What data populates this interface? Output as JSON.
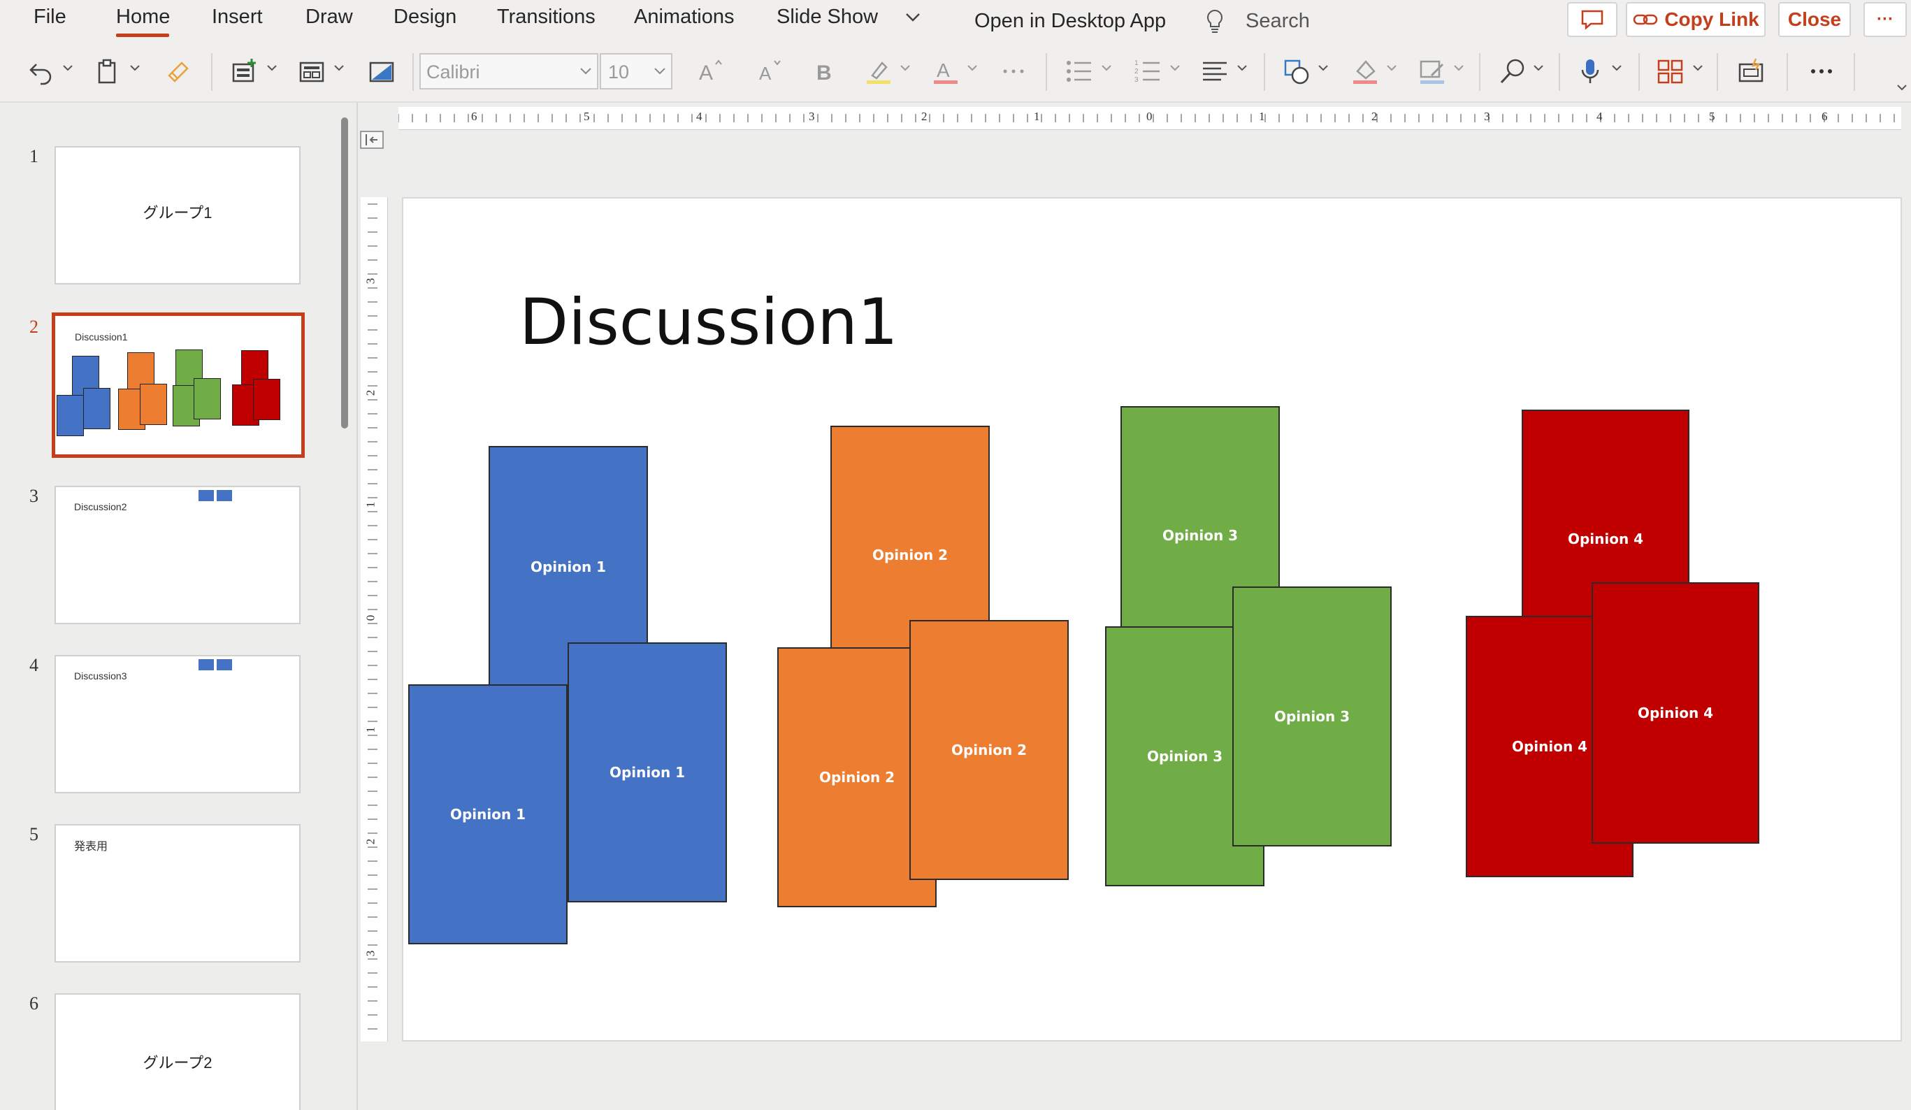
{
  "menu": {
    "file": "File",
    "home": "Home",
    "insert": "Insert",
    "draw": "Draw",
    "design": "Design",
    "transitions": "Transitions",
    "animations": "Animations",
    "slideshow": "Slide Show",
    "open_desktop": "Open in Desktop App",
    "search": "Search",
    "copy_link": "Copy Link",
    "close": "Close",
    "more": "···"
  },
  "toolbar": {
    "font": "Calibri",
    "size": "10"
  },
  "ruler": {
    "h": [
      "6",
      "5",
      "4",
      "3",
      "2",
      "1",
      "0",
      "1",
      "2",
      "3",
      "4",
      "5",
      "6"
    ],
    "v": [
      "3",
      "2",
      "1",
      "0",
      "1",
      "2",
      "3"
    ]
  },
  "thumbnails": [
    {
      "num": "1",
      "title": "グループ1"
    },
    {
      "num": "2",
      "title": "Discussion1"
    },
    {
      "num": "3",
      "title": "Discussion2"
    },
    {
      "num": "4",
      "title": "Discussion3"
    },
    {
      "num": "5",
      "title": "発表用"
    },
    {
      "num": "6",
      "title": "グループ2"
    }
  ],
  "slide": {
    "title": "Discussion1",
    "cards": {
      "o1": "Opinion 1",
      "o2": "Opinion 2",
      "o3": "Opinion 3",
      "o4": "Opinion 4"
    }
  },
  "colors": {
    "accent": "#c43e1c",
    "blue": "#4472c4",
    "orange": "#ed7d31",
    "green": "#70ad47",
    "red": "#c00000"
  }
}
